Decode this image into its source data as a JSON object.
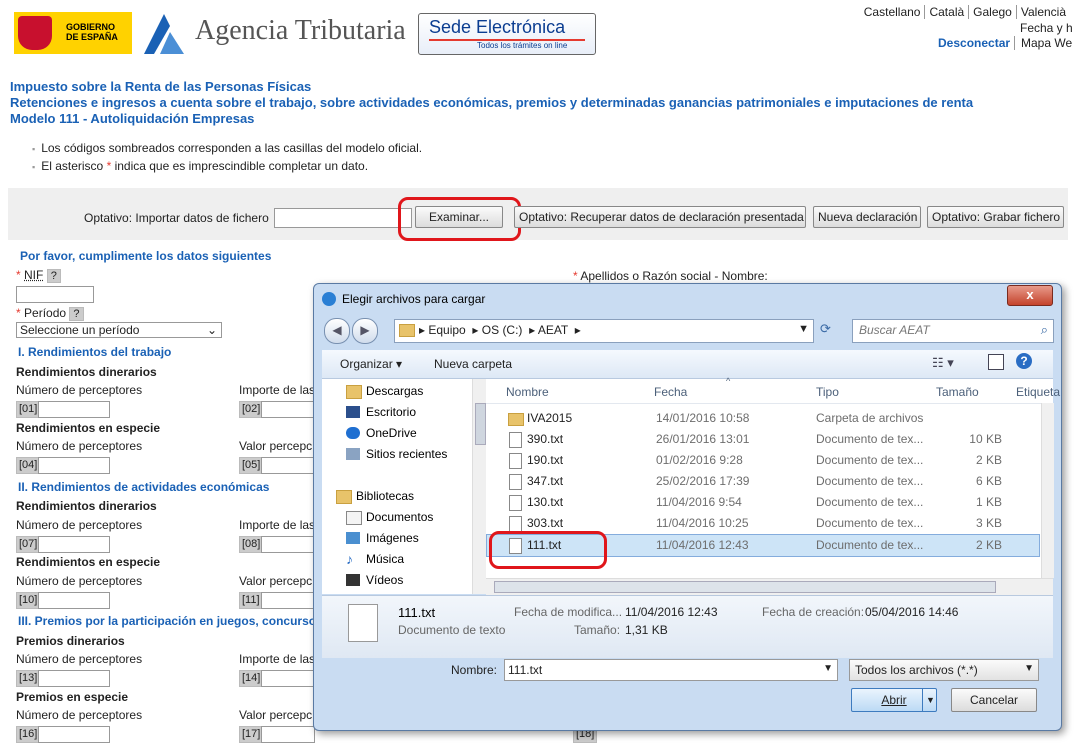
{
  "header": {
    "gobierno": [
      "GOBIERNO",
      "DE ESPAÑA"
    ],
    "agency": "Agencia Tributaria",
    "sede_title": "Sede Electrónica",
    "sede_subtitle": "Todos los trámites on line",
    "languages": [
      "Castellano",
      "Català",
      "Galego",
      "Valencià"
    ],
    "fecha": "Fecha y h",
    "logout": "Desconectar",
    "sitemap": "Mapa We"
  },
  "titles": [
    "Impuesto sobre la Renta de las Personas Físicas",
    "Retenciones e ingresos a cuenta sobre el trabajo, sobre actividades económicas, premios y determinadas ganancias patrimoniales e imputaciones de renta",
    "Modelo 111 - Autoliquidación Empresas"
  ],
  "notes": {
    "shaded": "Los códigos sombreados corresponden a las casillas del modelo oficial.",
    "asterisk_pre": "El asterisco ",
    "asterisk_mark": "*",
    "asterisk_post": " indica que es imprescindible completar un dato."
  },
  "toolbar": {
    "import_label": "Optativo: Importar datos de fichero",
    "browse": "Examinar...",
    "recover": "Optativo: Recuperar datos de declaración presentada",
    "new": "Nueva declaración",
    "save": "Optativo: Grabar fichero"
  },
  "form": {
    "intro": "Por favor, cumplimente los datos siguientes",
    "req_mark": "*",
    "nif": "NIF",
    "help": "?",
    "periodo": "Período",
    "periodo_value": "Seleccione un período",
    "apellidos": "Apellidos o Razón social - Nombre:",
    "sections": [
      {
        "title": "I. Rendimientos del trabajo",
        "blocks": [
          {
            "sub": "Rendimientos dinerarios",
            "l1": "Número de perceptores",
            "l2": "Importe de las",
            "c1": "[01]",
            "c2": "[02]"
          },
          {
            "sub": "Rendimientos en especie",
            "l1": "Número de perceptores",
            "l2": "Valor percepc",
            "c1": "[04]",
            "c2": "[05]"
          }
        ]
      },
      {
        "title": "II. Rendimientos de actividades económicas",
        "blocks": [
          {
            "sub": "Rendimientos dinerarios",
            "l1": "Número de perceptores",
            "l2": "Importe de las",
            "c1": "[07]",
            "c2": "[08]"
          },
          {
            "sub": "Rendimientos en especie",
            "l1": "Número de perceptores",
            "l2": "Valor percepc",
            "c1": "[10]",
            "c2": "[11]"
          }
        ]
      },
      {
        "title": "III. Premios por la participación en juegos, concurso",
        "blocks": [
          {
            "sub": "Premios dinerarios",
            "l1": "Número de perceptores",
            "l2": "Importe de las",
            "c1": "[13]",
            "c2": "[14]"
          },
          {
            "sub": "Premios en especie",
            "l1": "Número de perceptores",
            "l2": "Valor percepc",
            "c1": "[16]",
            "c2": "[17]"
          }
        ]
      }
    ],
    "code_18": "[18]"
  },
  "dialog": {
    "title": "Elegir archivos para cargar",
    "close": "x",
    "path": [
      "Equipo",
      "OS (C:)",
      "AEAT"
    ],
    "search_placeholder": "Buscar AEAT",
    "organize": "Organizar",
    "new_folder": "Nueva carpeta",
    "nav": [
      "Descargas",
      "Escritorio",
      "OneDrive",
      "Sitios recientes",
      "Bibliotecas",
      "Documentos",
      "Imágenes",
      "Música",
      "Vídeos"
    ],
    "columns": [
      "Nombre",
      "Fecha",
      "Tipo",
      "Tamaño",
      "Etiqueta"
    ],
    "files": [
      {
        "name": "IVA2015",
        "date": "14/01/2016 10:58",
        "type": "Carpeta de archivos",
        "size": "",
        "folder": true
      },
      {
        "name": "390.txt",
        "date": "26/01/2016 13:01",
        "type": "Documento de tex...",
        "size": "10 KB"
      },
      {
        "name": "190.txt",
        "date": "01/02/2016 9:28",
        "type": "Documento de tex...",
        "size": "2 KB"
      },
      {
        "name": "347.txt",
        "date": "25/02/2016 17:39",
        "type": "Documento de tex...",
        "size": "6 KB"
      },
      {
        "name": "130.txt",
        "date": "11/04/2016 9:54",
        "type": "Documento de tex...",
        "size": "1 KB"
      },
      {
        "name": "303.txt",
        "date": "11/04/2016 10:25",
        "type": "Documento de tex...",
        "size": "3 KB"
      },
      {
        "name": "111.txt",
        "date": "11/04/2016 12:43",
        "type": "Documento de tex...",
        "size": "2 KB",
        "selected": true
      }
    ],
    "details": {
      "name": "111.txt",
      "type": "Documento de texto",
      "mod_label": "Fecha de modifica...",
      "mod_value": "11/04/2016 12:43",
      "created_label": "Fecha de creación:",
      "created_value": "05/04/2016 14:46",
      "size_label": "Tamaño:",
      "size_value": "1,31 KB"
    },
    "filename_label": "Nombre:",
    "filename_value": "111.txt",
    "filter": "Todos los archivos (*.*)",
    "open": "Abrir",
    "cancel": "Cancelar"
  }
}
